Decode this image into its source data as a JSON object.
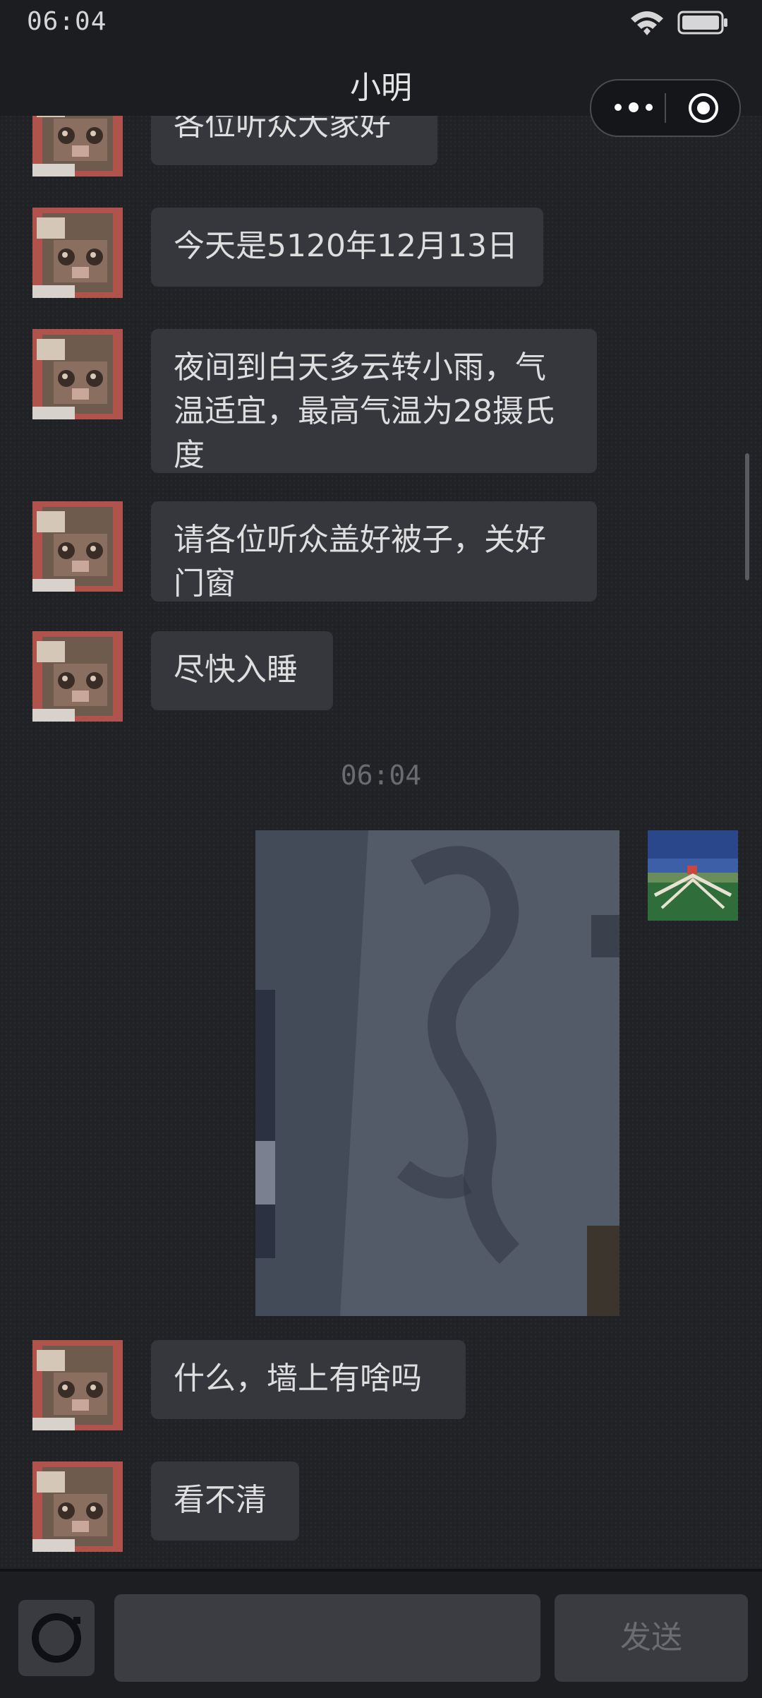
{
  "status_bar": {
    "time": "06:04"
  },
  "header": {
    "title": "小明"
  },
  "messages": [
    {
      "text": "各位听众大家好"
    },
    {
      "text": "今天是5120年12月13日"
    },
    {
      "text": "夜间到白天多云转小雨，气温适宜，最高气温为28摄氏度"
    },
    {
      "text": "请各位听众盖好被子，关好门窗"
    },
    {
      "text": "尽快入睡"
    },
    {
      "text": "什么，墙上有啥吗"
    },
    {
      "text": "看不清"
    }
  ],
  "timestamp": "06:04",
  "input": {
    "send_label": "发送"
  }
}
